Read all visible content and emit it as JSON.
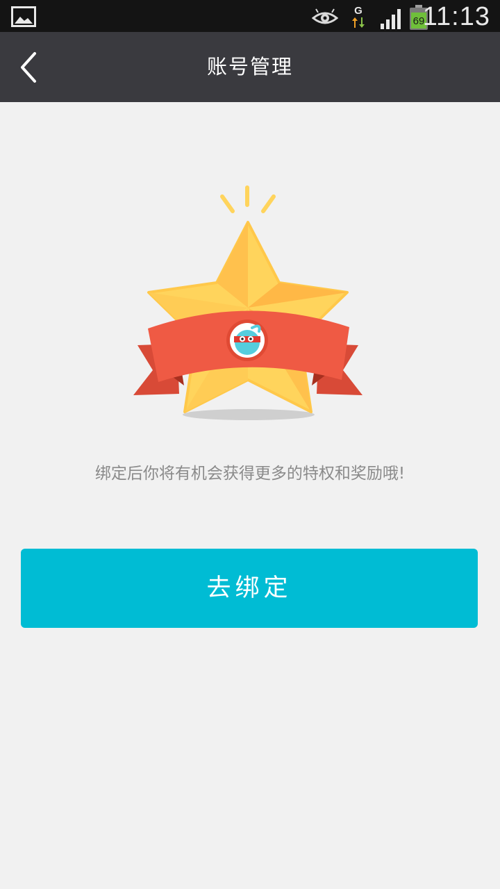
{
  "status_bar": {
    "time": "11:13",
    "network_type": "G",
    "battery_level": "69",
    "icons": [
      "image-notification-icon",
      "eye-icon",
      "network-g-icon",
      "signal-icon",
      "battery-icon"
    ]
  },
  "header": {
    "title": "账号管理",
    "back_icon": "back-arrow-icon"
  },
  "main": {
    "illustration": "star-badge-ribbon-illustration",
    "hint": "绑定后你将有机会获得更多的特权和奖励哦!",
    "bind_button_label": "去绑定"
  },
  "colors": {
    "status_bar_bg": "#141414",
    "header_bg": "#3a3a3f",
    "page_bg": "#f1f1f1",
    "accent": "#00bcd4",
    "star": "#ffd45c",
    "ribbon": "#ef5a44"
  }
}
